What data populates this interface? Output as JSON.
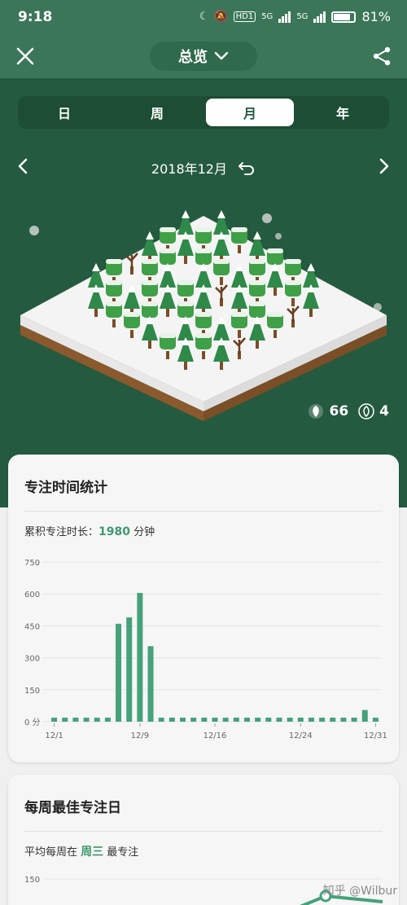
{
  "status": {
    "time": "9:18",
    "battery": "81%",
    "net1": "5G",
    "net2": "5G",
    "hd": "HD1"
  },
  "appbar": {
    "title": "总览",
    "close_icon": "close-icon",
    "share_icon": "share-icon"
  },
  "tabs": [
    {
      "label": "日",
      "active": false
    },
    {
      "label": "周",
      "active": false
    },
    {
      "label": "月",
      "active": true
    },
    {
      "label": "年",
      "active": false
    }
  ],
  "datenav": {
    "label": "2018年12月"
  },
  "counts": {
    "healthy": "66",
    "withered": "4"
  },
  "focus_card": {
    "title": "专注时间统计",
    "summary_prefix": "累积专注时长：",
    "summary_value": "1980",
    "summary_unit": " 分钟"
  },
  "weekday_card": {
    "title": "每周最佳专注日",
    "summary_prefix": "平均每周在 ",
    "summary_value": "周三",
    "summary_suffix": " 最专注"
  },
  "watermark": "知乎 @Wilbur",
  "colors": {
    "accent": "#3f9a6e",
    "dark_green": "#245a3f"
  },
  "chart_data": [
    {
      "type": "bar",
      "ylabel": "",
      "xlabel": "",
      "yticks": [
        "0 分",
        "150",
        "300",
        "450",
        "600",
        "750"
      ],
      "ylim": [
        0,
        750
      ],
      "xtick_labels": [
        "12/1",
        "12/9",
        "12/16",
        "12/24",
        "12/31"
      ],
      "xtick_days": [
        1,
        9,
        16,
        24,
        31
      ],
      "days": [
        1,
        2,
        3,
        4,
        5,
        6,
        7,
        8,
        9,
        10,
        11,
        12,
        13,
        14,
        15,
        16,
        17,
        18,
        19,
        20,
        21,
        22,
        23,
        24,
        25,
        26,
        27,
        28,
        29,
        30,
        31
      ],
      "values": [
        0,
        0,
        0,
        0,
        0,
        0,
        460,
        490,
        605,
        355,
        0,
        0,
        0,
        0,
        0,
        0,
        0,
        0,
        0,
        0,
        0,
        0,
        0,
        0,
        0,
        0,
        0,
        0,
        0,
        55,
        0
      ]
    },
    {
      "type": "line",
      "ylabel": "",
      "yticks": [
        "150"
      ],
      "ylim": [
        0,
        150
      ]
    }
  ]
}
